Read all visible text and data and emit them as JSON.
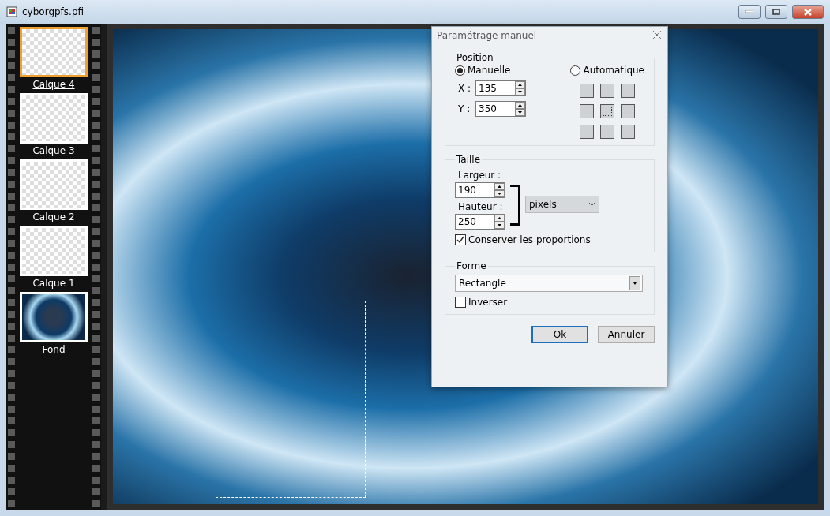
{
  "window": {
    "title": "cyborgpfs.pfi"
  },
  "layers": [
    {
      "name": "Calque 4",
      "selected": true,
      "kind": "transparent"
    },
    {
      "name": "Calque 3",
      "selected": false,
      "kind": "transparent"
    },
    {
      "name": "Calque 2",
      "selected": false,
      "kind": "transparent"
    },
    {
      "name": "Calque 1",
      "selected": false,
      "kind": "transparent"
    },
    {
      "name": "Fond",
      "selected": false,
      "kind": "image"
    }
  ],
  "dialog": {
    "title": "Paramétrage manuel",
    "position": {
      "label": "Position",
      "modes": [
        {
          "label": "Manuelle",
          "selected": true
        },
        {
          "label": "Automatique",
          "selected": false
        }
      ],
      "x_label": "X :",
      "x_value": "135",
      "y_label": "Y :",
      "y_value": "350",
      "anchors": [
        {
          "selected": false
        },
        {
          "selected": false
        },
        {
          "selected": false
        },
        {
          "selected": false
        },
        {
          "selected": true
        },
        {
          "selected": false
        },
        {
          "selected": false
        },
        {
          "selected": false
        },
        {
          "selected": false
        }
      ]
    },
    "size": {
      "label": "Taille",
      "width_label": "Largeur :",
      "width_value": "190",
      "height_label": "Hauteur :",
      "height_value": "250",
      "unit": "pixels",
      "keep_ratio": {
        "label": "Conserver les proportions",
        "checked": true
      }
    },
    "shape": {
      "label": "Forme",
      "value": "Rectangle",
      "invert": {
        "label": "Inverser",
        "checked": false
      }
    },
    "buttons": [
      {
        "label": "Ok",
        "default": true
      },
      {
        "label": "Annuler",
        "default": false
      }
    ]
  }
}
